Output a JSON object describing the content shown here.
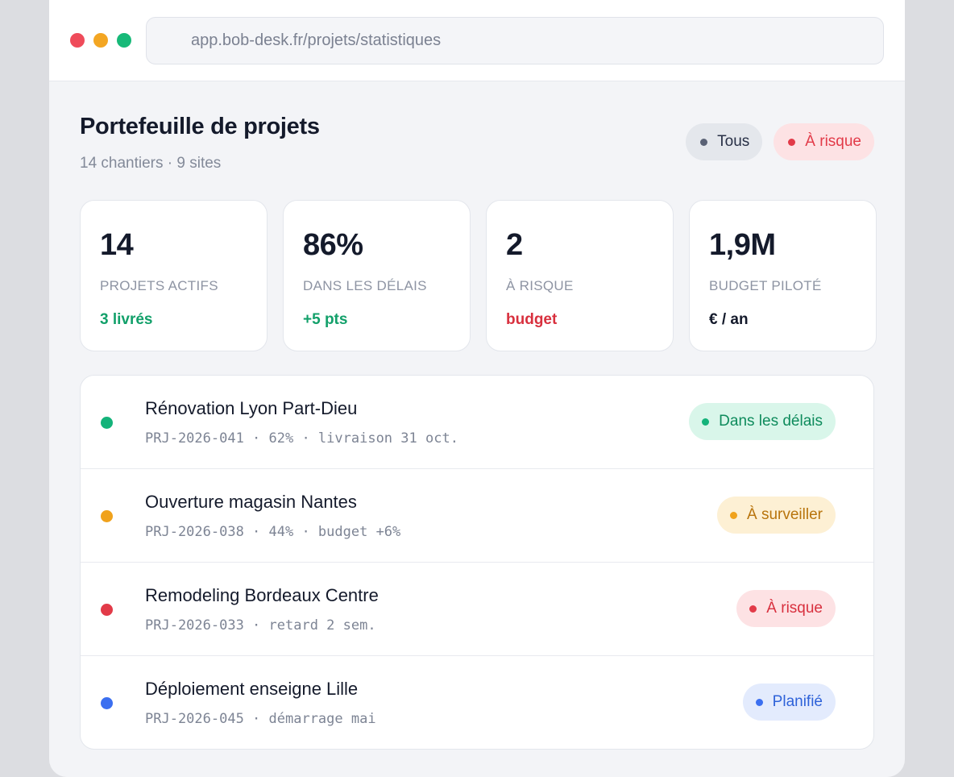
{
  "browser": {
    "url": "app.bob-desk.fr/projets/statistiques"
  },
  "header": {
    "title": "Portefeuille de projets",
    "subtitle": "14 chantiers · 9 sites"
  },
  "filters": [
    {
      "label": "Tous",
      "color": "#5a6275"
    },
    {
      "label": "À risque",
      "color": "#e23a48"
    }
  ],
  "kpis": [
    {
      "value": "14",
      "label": "PROJETS ACTIFS",
      "note": "3 livrés",
      "note_color": "#12a06a"
    },
    {
      "value": "86%",
      "label": "DANS LES DÉLAIS",
      "note": "+5 pts",
      "note_color": "#12a06a"
    },
    {
      "value": "2",
      "label": "À RISQUE",
      "note": "budget",
      "note_color": "#d8303e"
    },
    {
      "value": "1,9M",
      "label": "BUDGET PILOTÉ",
      "note": "€ / an",
      "note_color": "#141a2b"
    }
  ],
  "projects": [
    {
      "name": "Rénovation Lyon Part-Dieu",
      "meta": "PRJ-2026-041 · 62% · livraison 31 oct.",
      "status": "Dans les délais",
      "color": "#14b37a"
    },
    {
      "name": "Ouverture magasin Nantes",
      "meta": "PRJ-2026-038 · 44% · budget +6%",
      "status": "À surveiller",
      "color": "#f0a21c"
    },
    {
      "name": "Remodeling Bordeaux Centre",
      "meta": "PRJ-2026-033 · retard 2 sem.",
      "status": "À risque",
      "color": "#e23a48"
    },
    {
      "name": "Déploiement enseigne Lille",
      "meta": "PRJ-2026-045 · démarrage mai",
      "status": "Planifié",
      "color": "#3b6ff0"
    }
  ]
}
